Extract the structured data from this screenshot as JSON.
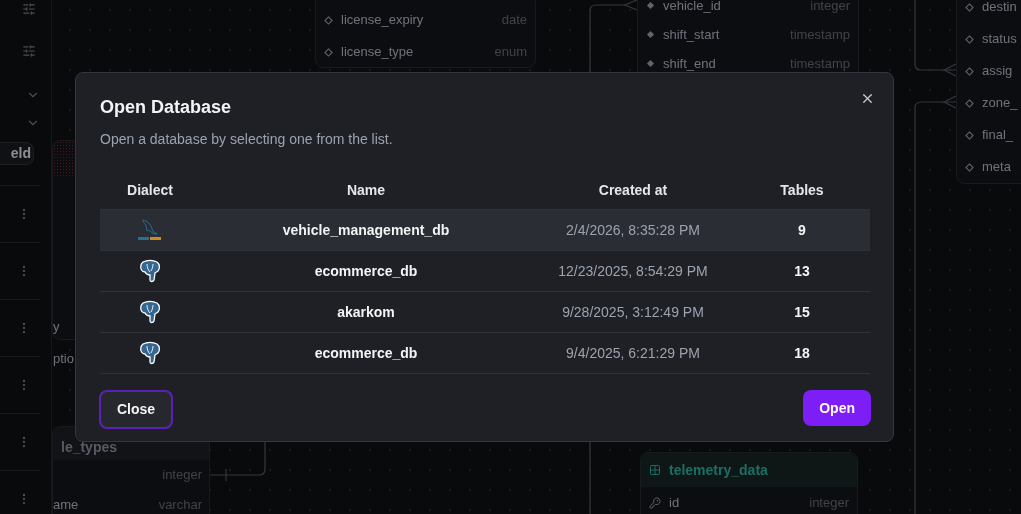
{
  "sidebar": {
    "field_button": "eld"
  },
  "canvas": {
    "tables": [
      {
        "fields": [
          {
            "name": "license_expiry",
            "type": "date",
            "kind": "outline"
          },
          {
            "name": "license_type",
            "type": "enum",
            "kind": "outline"
          }
        ]
      },
      {
        "fields": [
          {
            "name": "vehicle_id",
            "type": "integer",
            "kind": "filled"
          },
          {
            "name": "shift_start",
            "type": "timestamp",
            "kind": "filled"
          },
          {
            "name": "shift_end",
            "type": "timestamp",
            "kind": "filled"
          }
        ]
      },
      {
        "fields": [
          {
            "name": "destin",
            "kind": "outline"
          },
          {
            "name": "status",
            "kind": "outline"
          },
          {
            "name": "assig",
            "kind": "outline"
          },
          {
            "name": "zone_",
            "kind": "outline"
          },
          {
            "name": "final_",
            "kind": "outline"
          },
          {
            "name": "meta",
            "kind": "outline"
          }
        ]
      },
      {
        "fields": [
          {
            "name": "y",
            "kind": "none"
          },
          {
            "name": "ptio",
            "kind": "none"
          }
        ]
      },
      {
        "title": "le_types",
        "fields": [
          {
            "type": "integer",
            "kind": "none"
          },
          {
            "name": "ame",
            "type": "varchar",
            "kind": "none"
          }
        ]
      },
      {
        "title": "telemetry_data",
        "fields": [
          {
            "name": "id",
            "type": "integer",
            "kind": "key"
          }
        ]
      }
    ]
  },
  "dialog": {
    "title": "Open Database",
    "description": "Open a database by selecting one from the list.",
    "columns": [
      "Dialect",
      "Name",
      "Created at",
      "Tables"
    ],
    "rows": [
      {
        "kind": "mysql",
        "name": "vehicle_management_db",
        "created": "2/4/2026, 8:35:28 PM",
        "tables": "9",
        "selected": true
      },
      {
        "kind": "postgresql",
        "name": "ecommerce_db",
        "created": "12/23/2025, 8:54:29 PM",
        "tables": "13",
        "selected": false
      },
      {
        "kind": "postgresql",
        "name": "akarkom",
        "created": "9/28/2025, 3:12:49 PM",
        "tables": "15",
        "selected": false
      },
      {
        "kind": "postgresql",
        "name": "ecommerce_db",
        "created": "9/4/2025, 6:21:29 PM",
        "tables": "18",
        "selected": false
      }
    ],
    "buttons": [
      {
        "label": "Close",
        "kind": "secondary"
      },
      {
        "label": "Open",
        "kind": "primary"
      }
    ]
  }
}
